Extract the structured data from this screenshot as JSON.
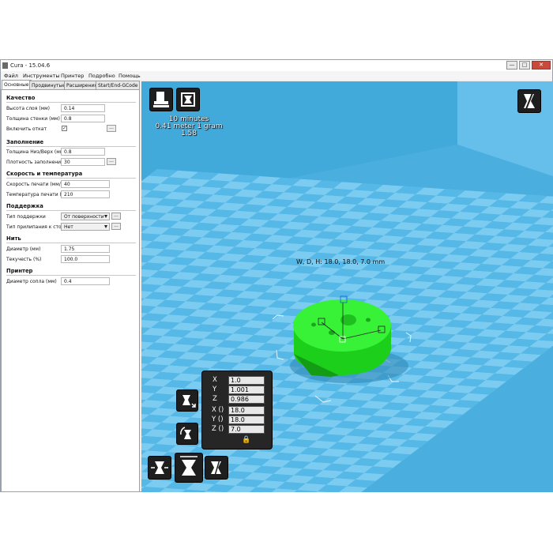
{
  "window": {
    "title": "Cura - 15.04.6"
  },
  "titlebar_buttons": {
    "minimize": "—",
    "maximize": "□",
    "close": "✕"
  },
  "menu": [
    "Файл",
    "Инструменты",
    "Принтер",
    "Подробно",
    "Помощь"
  ],
  "tabs": [
    "Основные",
    "Продвинутые",
    "Расширения",
    "Start/End-GCode"
  ],
  "sections": {
    "quality": {
      "title": "Качество",
      "layer_height": {
        "label": "Высота слоя (мм)",
        "value": "0.14"
      },
      "shell_thickness": {
        "label": "Толщина стенки (мм)",
        "value": "0.8"
      },
      "retraction": {
        "label": "Включить откат",
        "checked": "✓",
        "more": "..."
      }
    },
    "fill": {
      "title": "Заполнение",
      "bottom_top": {
        "label": "Толщина Низ/Верх (мм)",
        "value": "0.8"
      },
      "fill_density": {
        "label": "Плотность заполнения",
        "value": "30",
        "more": "..."
      }
    },
    "speed": {
      "title": "Скорость и температура",
      "print_speed": {
        "label": "Скорость печати (мм/с)",
        "value": "40"
      },
      "print_temp": {
        "label": "Температура печати (C)",
        "value": "210"
      }
    },
    "support": {
      "title": "Поддержка",
      "support_type": {
        "label": "Тип поддержки",
        "value": "От поверхности",
        "more": "..."
      },
      "adhesion": {
        "label": "Тип прилипания к столу",
        "value": "Нет",
        "more": "..."
      }
    },
    "filament": {
      "title": "Нить",
      "diameter": {
        "label": "Диаметр (мм)",
        "value": "1.75"
      },
      "flow": {
        "label": "Текучесть (%)",
        "value": "100.0"
      }
    },
    "machine": {
      "title": "Принтер",
      "nozzle": {
        "label": "Диаметр сопла (мм)",
        "value": "0.4"
      }
    }
  },
  "print_info": {
    "time": "10 minutes",
    "material": "0.41 meter 1 gram",
    "cost": "1.58"
  },
  "model_dims": "W, D, H: 18.0, 18.0, 7.0 mm",
  "scale": {
    "labels": [
      "X",
      "Y",
      "Z",
      "X ()",
      "Y ()",
      "Z ()"
    ],
    "x": "1.0",
    "y": "1.001",
    "z": "0.986",
    "sx": "18.0",
    "sy": "18.0",
    "sz": "7.0",
    "lock": "🔒"
  },
  "colors": {
    "viewport_bg": "#4fb4e2",
    "model": "#22ee22",
    "toolbar": "#1e1e1e",
    "accent_blue": "#1a5fd0"
  },
  "icons": [
    "load-model-icon",
    "print-icon",
    "view-mode-icon",
    "scale-tool-icon",
    "rotate-tool-icon",
    "mirror-tool-icon"
  ]
}
